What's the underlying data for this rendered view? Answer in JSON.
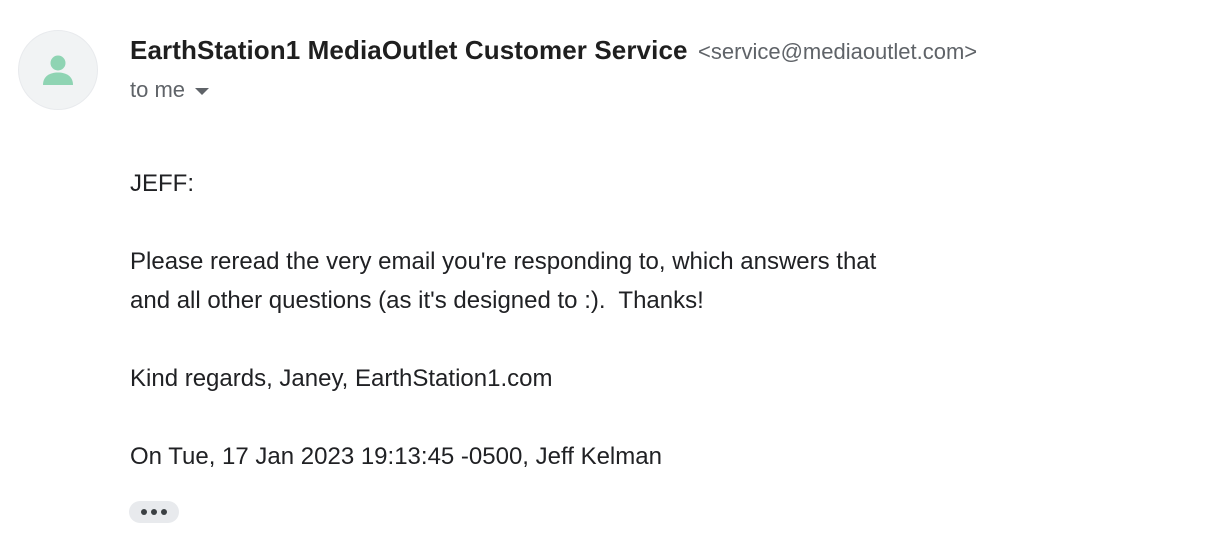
{
  "sender": {
    "name": "EarthStation1 MediaOutlet Customer Service",
    "email": "<service@mediaoutlet.com>",
    "recipient_label": "to me",
    "avatar_icon": "person-icon",
    "avatar_color": "#8fd4b3"
  },
  "message": {
    "greeting": "JEFF:",
    "paragraph1": "Please reread the very email you're responding to, which answers that\nand all other questions (as it's designed to :).  Thanks!",
    "signoff": "Kind regards, Janey, EarthStation1.com",
    "quote_header": "On Tue, 17 Jan 2023 19:13:45 -0500, Jeff Kelman"
  },
  "controls": {
    "show_trimmed_icon": "more-horiz-icon",
    "recipient_toggle_icon": "caret-down-icon"
  }
}
